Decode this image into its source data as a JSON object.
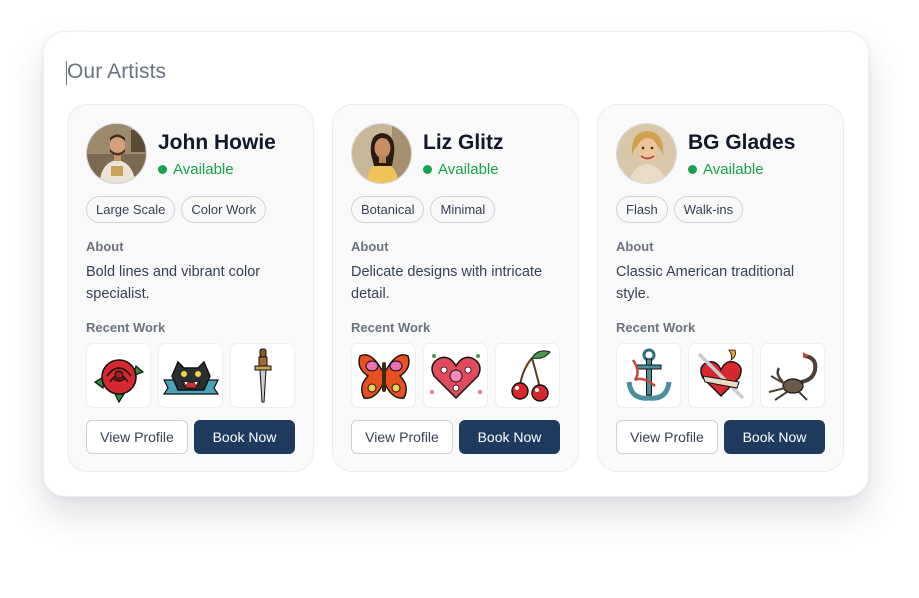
{
  "page": {
    "title": "Our Artists"
  },
  "artists": [
    {
      "name": "John Howie",
      "status": "Available",
      "tags": [
        "Large Scale",
        "Color Work"
      ],
      "about_label": "About",
      "about": "Bold lines and vibrant color specialist.",
      "recent_work_label": "Recent Work",
      "works": [
        "rose-tattoo",
        "panther-tattoo",
        "dagger-tattoo"
      ],
      "view_profile_label": "View Profile",
      "book_label": "Book Now"
    },
    {
      "name": "Liz Glitz",
      "status": "Available",
      "tags": [
        "Botanical",
        "Minimal"
      ],
      "about_label": "About",
      "about": "Delicate designs with intricate detail.",
      "recent_work_label": "Recent Work",
      "works": [
        "butterfly-tattoo",
        "floral-heart-tattoo",
        "cherries-tattoo"
      ],
      "view_profile_label": "View Profile",
      "book_label": "Book Now"
    },
    {
      "name": "BG Glades",
      "status": "Available",
      "tags": [
        "Flash",
        "Walk-ins"
      ],
      "about_label": "About",
      "about": "Classic American traditional style.",
      "recent_work_label": "Recent Work",
      "works": [
        "anchor-tattoo",
        "heart-dagger-tattoo",
        "scorpion-tattoo"
      ],
      "view_profile_label": "View Profile",
      "book_label": "Book Now"
    }
  ],
  "colors": {
    "available": "#16a34a",
    "book_button": "#1e3a5f",
    "card_background": "#f9f9fa"
  }
}
